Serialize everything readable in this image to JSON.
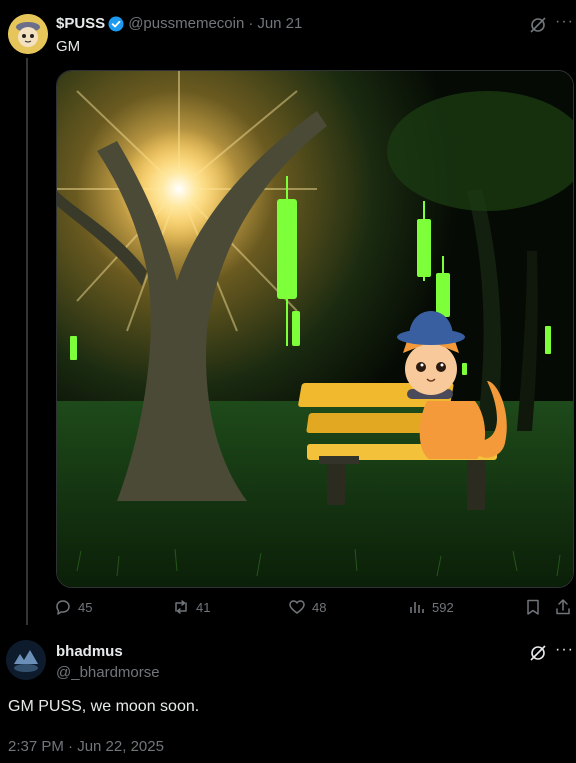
{
  "tweet": {
    "author_name": "$PUSS",
    "handle": "@pussmemecoin",
    "separator": "·",
    "date": "Jun 21",
    "text": "GM",
    "stats": {
      "replies": "45",
      "reposts": "41",
      "likes": "48",
      "views": "592"
    },
    "image_icon": "cat-on-bench-candlestick-illustration"
  },
  "reply": {
    "author_name": "bhadmus",
    "handle": "@_bhardmorse",
    "text": "GM PUSS, we moon soon.",
    "timestamp": "2:37 PM · Jun 22, 2025"
  },
  "icons": {
    "verified": "verified-badge-icon",
    "grok": "grok-icon",
    "more": "more-icon",
    "reply": "reply-icon",
    "repost": "repost-icon",
    "like": "heart-icon",
    "views": "analytics-icon",
    "bookmark": "bookmark-icon",
    "share": "share-icon"
  },
  "colors": {
    "background": "#000000",
    "text": "#e7e9ea",
    "muted": "#71767b",
    "verified": "#1d9bf0",
    "candle_green": "#7dff3a"
  }
}
